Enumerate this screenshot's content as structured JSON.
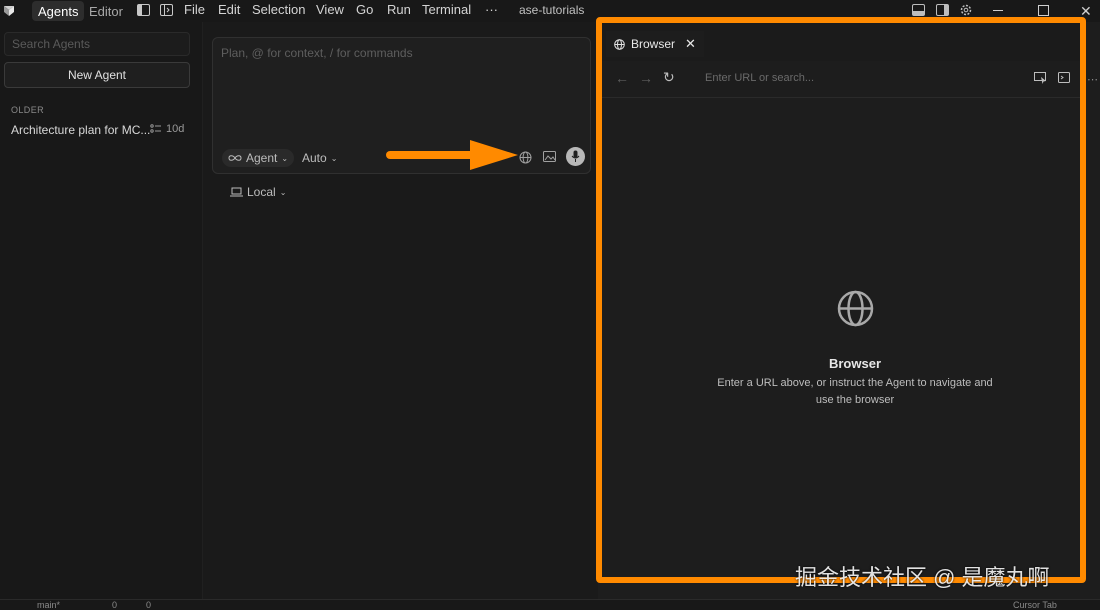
{
  "titlebar": {
    "tabs": {
      "agents": "Agents",
      "editor": "Editor"
    },
    "menu": [
      "File",
      "Edit",
      "Selection",
      "View",
      "Go",
      "Run",
      "Terminal"
    ],
    "more": "···",
    "workspace": "ase-tutorials"
  },
  "sidebar": {
    "search_placeholder": "Search Agents",
    "new_agent": "New Agent",
    "section": "OLDER",
    "items": [
      {
        "title": "Architecture plan for MC...",
        "age": "10d"
      }
    ]
  },
  "composer": {
    "placeholder": "Plan, @ for context, / for commands",
    "mode": "Agent",
    "model": "Auto",
    "location": "Local"
  },
  "browser": {
    "tab_label": "Browser",
    "url_placeholder": "Enter URL or search...",
    "empty_title": "Browser",
    "empty_text_line1": "Enter a URL above, or instruct the Agent to navigate and",
    "empty_text_line2": "use the browser"
  },
  "statusbar": {
    "branch": "main*",
    "problems": "0",
    "warnings": "0",
    "right": "Cursor Tab"
  },
  "watermark": "掘金技术社区 @ 是魔丸啊",
  "colors": {
    "accent": "#ff8a00",
    "bg": "#181818"
  }
}
